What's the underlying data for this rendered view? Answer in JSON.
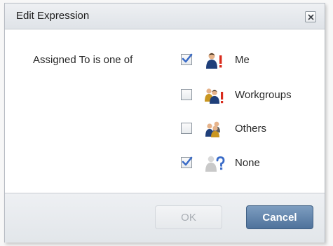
{
  "dialog": {
    "title": "Edit Expression",
    "close_icon": "close-icon"
  },
  "expression": {
    "label": "Assigned To is one of",
    "options": [
      {
        "label": "Me",
        "checked": true,
        "icon": "user-icon"
      },
      {
        "label": "Workgroups",
        "checked": false,
        "icon": "workgroup-icon"
      },
      {
        "label": "Others",
        "checked": false,
        "icon": "others-icon"
      },
      {
        "label": "None",
        "checked": true,
        "icon": "unassigned-icon"
      }
    ]
  },
  "buttons": {
    "ok_label": "OK",
    "ok_enabled": false,
    "cancel_label": "Cancel"
  },
  "colors": {
    "checkmark": "#3a6bc7",
    "accent_user": "#1f3f7a",
    "alert_red": "#d92b1c",
    "primary_button": "#5b7ea6"
  }
}
